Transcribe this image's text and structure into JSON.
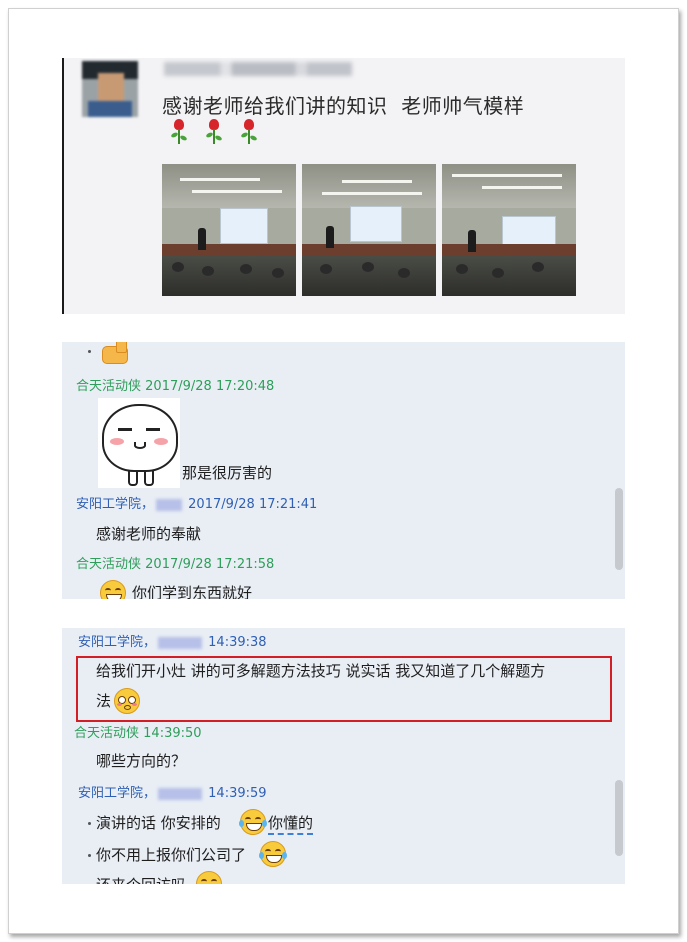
{
  "moment": {
    "caption": "感谢老师给我们讲的知识  老师帅气模样",
    "emojis": [
      "rose-icon",
      "rose-icon",
      "rose-icon"
    ],
    "photo_count": 3
  },
  "chat_top": {
    "messages": [
      {
        "sender": "合天活动侠",
        "time": "2017/9/28 17:20:48",
        "text": "那是很厉害的"
      },
      {
        "sender": "安阳工学院，",
        "time": "2017/9/28 17:21:41",
        "text": "感谢老师的奉献"
      },
      {
        "sender": "合天活动侠",
        "time": "2017/9/28 17:21:58",
        "text": "你们学到东西就好"
      }
    ]
  },
  "chat_bottom": {
    "messages": [
      {
        "sender": "安阳工学院，",
        "time": "14:39:38",
        "text_line1": "给我们开小灶  讲的可多解题方法技巧  说实话   我又知道了几个解题方",
        "text_line2": "法"
      },
      {
        "sender": "合天活动侠",
        "time": "14:39:50",
        "text": "哪些方向的？"
      },
      {
        "sender": "安阳工学院，",
        "time": "14:39:59",
        "lines": [
          "演讲的话  你安排的",
          "你懂的",
          "你不用上报你们公司了",
          "还来个回访吗"
        ]
      }
    ]
  },
  "colors": {
    "sender_green": "#2e9e5a",
    "sender_blue": "#2e5fb4",
    "highlight_red": "#d41e26",
    "chat_bg": "#e9eef5"
  }
}
